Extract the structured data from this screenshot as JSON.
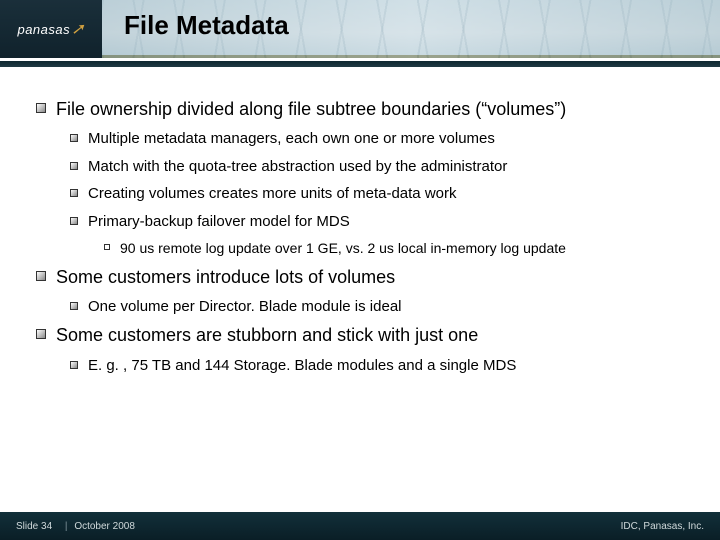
{
  "header": {
    "logo_text": "panasas",
    "title": "File Metadata"
  },
  "bullets": {
    "b1": "File ownership divided along file subtree boundaries (“volumes”)",
    "b1_1": "Multiple metadata managers, each own one or more volumes",
    "b1_2": "Match with the quota-tree abstraction used by the administrator",
    "b1_3": "Creating volumes creates more units of meta-data work",
    "b1_4": "Primary-backup failover model for MDS",
    "b1_4_1": "90 us remote log update over 1 GE, vs. 2 us local in-memory log update",
    "b2": "Some customers introduce lots of volumes",
    "b2_1": "One volume per Director. Blade module is ideal",
    "b3": "Some customers are stubborn and stick with just one",
    "b3_1": "E. g. , 75 TB and 144 Storage. Blade modules and a single MDS"
  },
  "footer": {
    "slide_label": "Slide 34",
    "date": "October 2008",
    "credit": "IDC, Panasas, Inc."
  }
}
